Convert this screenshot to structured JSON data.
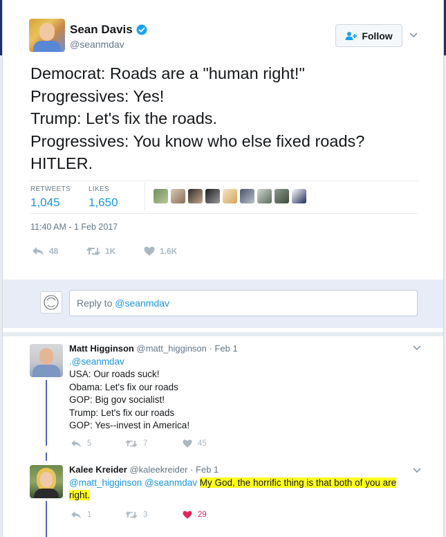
{
  "main_tweet": {
    "display_name": "Sean Davis",
    "handle": "@seanmdav",
    "follow_label": "Follow",
    "text_lines": [
      "Democrat: Roads are a \"human right!\"",
      "Progressives: Yes!",
      "Trump: Let's fix the roads.",
      "Progressives: You know who else fixed roads?",
      "HITLER."
    ],
    "retweets_label": "RETWEETS",
    "retweets_value": "1,045",
    "likes_label": "LIKES",
    "likes_value": "1,650",
    "timestamp": "11:40 AM - 1 Feb 2017",
    "actions": {
      "reply_count": "48",
      "retweet_count": "1K",
      "like_count": "1.6K"
    }
  },
  "reply_box": {
    "prefix": "Reply to ",
    "handle": "@seanmdav"
  },
  "replies": [
    {
      "display_name": "Matt Higginson",
      "handle": "@matt_higginson",
      "date": "· Feb 1",
      "mention_line": ".@seanmdav",
      "lines": [
        "USA: Our roads suck!",
        "Obama: Let's fix our roads",
        "GOP: Big gov socialist!",
        "Trump: Let's fix our roads",
        "GOP: Yes--invest in America!"
      ],
      "reply_count": "5",
      "retweet_count": "7",
      "like_count": "45"
    },
    {
      "display_name": "Kalee Kreider",
      "handle": "@kaleekreider",
      "date": "· Feb 1",
      "mentions": "@matt_higginson @seanmdav",
      "text_a": "My God, the horrific thing is that both of you are",
      "text_b": "right.",
      "reply_count": "1",
      "retweet_count": "3",
      "like_count": "29"
    }
  ],
  "colors": {
    "link_blue": "#1b95e0",
    "highlight": "#ffff1e",
    "like_red": "#e0245e",
    "thread_line": "#4a63c9",
    "reply_band": "#e8ecf7"
  },
  "icons": [
    "verified-badge-icon",
    "add-user-icon",
    "chevron-down-icon",
    "reply-icon",
    "retweet-icon",
    "heart-icon"
  ]
}
